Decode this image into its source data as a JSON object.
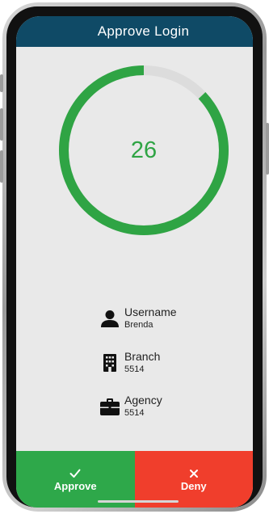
{
  "header": {
    "title": "Approve Login"
  },
  "timer": {
    "value": "26",
    "fraction_remaining": 0.87,
    "color": "#2fa444",
    "track_color": "#dcdcdc"
  },
  "info": [
    {
      "icon": "person-icon",
      "label": "Username",
      "value": "Brenda"
    },
    {
      "icon": "building-icon",
      "label": "Branch",
      "value": "5514"
    },
    {
      "icon": "briefcase-icon",
      "label": "Agency",
      "value": "5514"
    }
  ],
  "actions": {
    "approve_label": "Approve",
    "deny_label": "Deny",
    "approve_color": "#2ea84a",
    "deny_color": "#f03e2c"
  },
  "colors": {
    "header": "#0f4a66",
    "background": "#e9e9e9"
  }
}
